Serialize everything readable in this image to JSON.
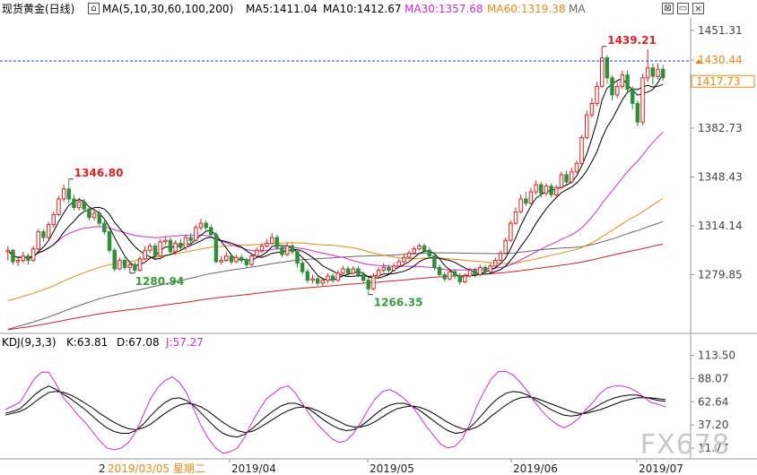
{
  "header": {
    "title": "现货黄金(日线)",
    "ma_label": "MA(5,10,30,60,100,200)",
    "ma5": "MA5:1411.04",
    "ma10": "MA10:1412.67",
    "ma30": "MA30:1357.68",
    "ma60": "MA60:1319.38",
    "ma_more": "MA"
  },
  "kdj_header": {
    "label": "KDJ(9,3,3)",
    "k": "K:63.81",
    "d": "D:67.08",
    "j": "J:57.27"
  },
  "colors": {
    "up": "#e02020",
    "down": "#2f8f3a",
    "ma5": "#000000",
    "ma10": "#000000",
    "ma30": "#d02ad0",
    "ma60": "#e88a10",
    "ma100": "#666666",
    "ma200": "#d42020",
    "current": "#1a3fd0",
    "k": "#000000",
    "d": "#000000",
    "j": "#d02ad0"
  },
  "chart_data": [
    {
      "type": "candlestick",
      "title": "现货黄金(日线)",
      "y_ticks": [
        1451.31,
        1430.44,
        1417.73,
        1382.73,
        1348.43,
        1314.14,
        1279.85
      ],
      "ylim": [
        1240,
        1460
      ],
      "current_price": "1417.73",
      "reference_price": "1430.44",
      "annotations": [
        {
          "label": "1346.80",
          "type": "high"
        },
        {
          "label": "1280.94",
          "type": "low"
        },
        {
          "label": "1266.35",
          "type": "low"
        },
        {
          "label": "1439.21",
          "type": "high"
        }
      ],
      "x_labels": [
        "2",
        "2019/03/05  星期二",
        "2019/04",
        "2019/05",
        "2019/06",
        "2019/07"
      ],
      "candles": [
        [
          1296,
          1297,
          1300,
          1290
        ],
        [
          1297,
          1289,
          1298,
          1287
        ],
        [
          1289,
          1290,
          1293,
          1286
        ],
        [
          1290,
          1293,
          1296,
          1288
        ],
        [
          1293,
          1290,
          1295,
          1287
        ],
        [
          1290,
          1298,
          1300,
          1289
        ],
        [
          1298,
          1310,
          1312,
          1297
        ],
        [
          1310,
          1306,
          1312,
          1303
        ],
        [
          1306,
          1315,
          1317,
          1305
        ],
        [
          1315,
          1322,
          1324,
          1313
        ],
        [
          1322,
          1333,
          1335,
          1321
        ],
        [
          1333,
          1340,
          1343,
          1331
        ],
        [
          1340,
          1333,
          1347,
          1330
        ],
        [
          1333,
          1327,
          1336,
          1325
        ],
        [
          1327,
          1331,
          1334,
          1325
        ],
        [
          1331,
          1326,
          1333,
          1324
        ],
        [
          1326,
          1320,
          1328,
          1318
        ],
        [
          1320,
          1323,
          1326,
          1318
        ],
        [
          1323,
          1316,
          1325,
          1314
        ],
        [
          1316,
          1310,
          1318,
          1308
        ],
        [
          1310,
          1297,
          1312,
          1295
        ],
        [
          1297,
          1284,
          1299,
          1282
        ],
        [
          1284,
          1290,
          1292,
          1283
        ],
        [
          1290,
          1285,
          1292,
          1283
        ],
        [
          1285,
          1287,
          1289,
          1281
        ],
        [
          1287,
          1283,
          1289,
          1281
        ],
        [
          1283,
          1291,
          1293,
          1282
        ],
        [
          1291,
          1297,
          1300,
          1290
        ],
        [
          1297,
          1300,
          1302,
          1295
        ],
        [
          1300,
          1293,
          1302,
          1291
        ],
        [
          1293,
          1303,
          1305,
          1292
        ],
        [
          1303,
          1304,
          1307,
          1301
        ],
        [
          1304,
          1296,
          1306,
          1294
        ],
        [
          1296,
          1302,
          1304,
          1294
        ],
        [
          1302,
          1299,
          1305,
          1297
        ],
        [
          1299,
          1306,
          1308,
          1297
        ],
        [
          1306,
          1304,
          1309,
          1302
        ],
        [
          1304,
          1313,
          1315,
          1303
        ],
        [
          1313,
          1316,
          1319,
          1311
        ],
        [
          1316,
          1313,
          1318,
          1311
        ],
        [
          1313,
          1308,
          1315,
          1306
        ],
        [
          1308,
          1289,
          1310,
          1288
        ],
        [
          1289,
          1290,
          1293,
          1287
        ],
        [
          1290,
          1293,
          1296,
          1289
        ],
        [
          1293,
          1289,
          1295,
          1287
        ],
        [
          1289,
          1292,
          1294,
          1288
        ],
        [
          1292,
          1290,
          1294,
          1288
        ],
        [
          1290,
          1287,
          1292,
          1285
        ],
        [
          1287,
          1293,
          1295,
          1286
        ],
        [
          1293,
          1297,
          1299,
          1292
        ],
        [
          1297,
          1300,
          1302,
          1295
        ],
        [
          1300,
          1302,
          1305,
          1299
        ],
        [
          1302,
          1306,
          1309,
          1301
        ],
        [
          1306,
          1299,
          1308,
          1297
        ],
        [
          1299,
          1294,
          1301,
          1292
        ],
        [
          1294,
          1300,
          1302,
          1293
        ],
        [
          1300,
          1296,
          1302,
          1294
        ],
        [
          1296,
          1288,
          1298,
          1285
        ],
        [
          1288,
          1282,
          1290,
          1280
        ],
        [
          1282,
          1276,
          1284,
          1274
        ],
        [
          1276,
          1277,
          1280,
          1274
        ],
        [
          1277,
          1274,
          1279,
          1272
        ],
        [
          1274,
          1276,
          1278,
          1272
        ],
        [
          1276,
          1279,
          1281,
          1274
        ],
        [
          1279,
          1276,
          1281,
          1274
        ],
        [
          1276,
          1281,
          1283,
          1275
        ],
        [
          1281,
          1284,
          1286,
          1280
        ],
        [
          1284,
          1281,
          1286,
          1279
        ],
        [
          1281,
          1284,
          1286,
          1280
        ],
        [
          1284,
          1280,
          1286,
          1278
        ],
        [
          1280,
          1276,
          1282,
          1274
        ],
        [
          1276,
          1270,
          1278,
          1266
        ],
        [
          1270,
          1279,
          1281,
          1269
        ],
        [
          1279,
          1283,
          1285,
          1278
        ],
        [
          1283,
          1285,
          1288,
          1281
        ],
        [
          1285,
          1283,
          1287,
          1281
        ],
        [
          1283,
          1286,
          1288,
          1282
        ],
        [
          1286,
          1289,
          1291,
          1285
        ],
        [
          1289,
          1292,
          1294,
          1288
        ],
        [
          1292,
          1295,
          1297,
          1291
        ],
        [
          1295,
          1298,
          1300,
          1294
        ],
        [
          1298,
          1300,
          1302,
          1297
        ],
        [
          1300,
          1297,
          1302,
          1295
        ],
        [
          1297,
          1293,
          1299,
          1291
        ],
        [
          1293,
          1285,
          1295,
          1283
        ],
        [
          1285,
          1280,
          1287,
          1278
        ],
        [
          1280,
          1277,
          1282,
          1275
        ],
        [
          1277,
          1282,
          1284,
          1276
        ],
        [
          1282,
          1279,
          1284,
          1277
        ],
        [
          1279,
          1275,
          1281,
          1273
        ],
        [
          1275,
          1279,
          1281,
          1274
        ],
        [
          1279,
          1283,
          1285,
          1278
        ],
        [
          1283,
          1280,
          1285,
          1278
        ],
        [
          1280,
          1285,
          1287,
          1279
        ],
        [
          1285,
          1282,
          1287,
          1280
        ],
        [
          1282,
          1286,
          1288,
          1281
        ],
        [
          1286,
          1290,
          1292,
          1285
        ],
        [
          1290,
          1295,
          1297,
          1289
        ],
        [
          1295,
          1304,
          1306,
          1294
        ],
        [
          1304,
          1316,
          1318,
          1303
        ],
        [
          1316,
          1324,
          1327,
          1315
        ],
        [
          1324,
          1333,
          1336,
          1323
        ],
        [
          1333,
          1330,
          1338,
          1328
        ],
        [
          1330,
          1338,
          1341,
          1329
        ],
        [
          1338,
          1343,
          1346,
          1336
        ],
        [
          1343,
          1337,
          1345,
          1334
        ],
        [
          1337,
          1342,
          1344,
          1335
        ],
        [
          1342,
          1336,
          1344,
          1334
        ],
        [
          1336,
          1341,
          1343,
          1334
        ],
        [
          1341,
          1350,
          1352,
          1340
        ],
        [
          1350,
          1345,
          1353,
          1343
        ],
        [
          1345,
          1352,
          1355,
          1344
        ],
        [
          1352,
          1358,
          1360,
          1351
        ],
        [
          1358,
          1376,
          1378,
          1357
        ],
        [
          1376,
          1392,
          1395,
          1375
        ],
        [
          1392,
          1400,
          1404,
          1390
        ],
        [
          1400,
          1412,
          1415,
          1398
        ],
        [
          1412,
          1432,
          1440,
          1411
        ],
        [
          1432,
          1418,
          1434,
          1414
        ],
        [
          1418,
          1406,
          1420,
          1402
        ],
        [
          1406,
          1412,
          1415,
          1404
        ],
        [
          1412,
          1420,
          1423,
          1410
        ],
        [
          1420,
          1410,
          1423,
          1407
        ],
        [
          1410,
          1400,
          1412,
          1396
        ],
        [
          1400,
          1387,
          1402,
          1384
        ],
        [
          1387,
          1418,
          1421,
          1385
        ],
        [
          1418,
          1425,
          1438,
          1415
        ],
        [
          1425,
          1419,
          1428,
          1413
        ],
        [
          1419,
          1424,
          1428,
          1417
        ],
        [
          1424,
          1418,
          1427,
          1416
        ]
      ]
    },
    {
      "type": "line",
      "title": "KDJ(9,3,3)",
      "y_ticks": [
        113.5,
        88.07,
        62.64,
        37.2,
        11.77
      ],
      "ylim": [
        0,
        120
      ],
      "series": [
        {
          "name": "K",
          "values": [
            50,
            52,
            55,
            62,
            70,
            76,
            80,
            76,
            71,
            66,
            60,
            54,
            47,
            40,
            34,
            30,
            28,
            28,
            31,
            38,
            47,
            55,
            62,
            66,
            67,
            64,
            58,
            50,
            42,
            34,
            28,
            25,
            24,
            27,
            33,
            40,
            47,
            53,
            58,
            61,
            61,
            58,
            54,
            48,
            42,
            37,
            33,
            31,
            32,
            36,
            42,
            49,
            55,
            59,
            61,
            61,
            58,
            54,
            48,
            42,
            36,
            31,
            28,
            29,
            34,
            42,
            51,
            60,
            67,
            72,
            74,
            73,
            70,
            65,
            60,
            55,
            51,
            48,
            47,
            48,
            51,
            55,
            60,
            64,
            67,
            69,
            70,
            70,
            68,
            66,
            64,
            63
          ]
        },
        {
          "name": "D",
          "values": [
            48,
            50,
            52,
            56,
            62,
            68,
            73,
            74,
            73,
            70,
            66,
            61,
            56,
            50,
            45,
            40,
            36,
            33,
            32,
            34,
            38,
            44,
            50,
            55,
            59,
            61,
            60,
            57,
            52,
            46,
            40,
            35,
            31,
            29,
            30,
            34,
            39,
            44,
            49,
            53,
            56,
            57,
            56,
            53,
            49,
            45,
            41,
            37,
            35,
            35,
            37,
            41,
            46,
            51,
            55,
            57,
            58,
            57,
            54,
            50,
            45,
            40,
            36,
            33,
            32,
            35,
            40,
            47,
            53,
            59,
            64,
            67,
            68,
            67,
            64,
            61,
            58,
            55,
            52,
            50,
            50,
            52,
            54,
            57,
            60,
            63,
            65,
            67,
            67,
            67,
            66,
            65
          ]
        },
        {
          "name": "J",
          "values": [
            54,
            58,
            62,
            75,
            88,
            95,
            95,
            82,
            67,
            58,
            48,
            40,
            30,
            20,
            12,
            10,
            12,
            18,
            30,
            48,
            66,
            78,
            86,
            90,
            84,
            72,
            54,
            36,
            22,
            12,
            6,
            8,
            12,
            24,
            40,
            54,
            66,
            72,
            78,
            80,
            72,
            60,
            48,
            38,
            30,
            22,
            18,
            20,
            28,
            40,
            54,
            66,
            74,
            76,
            72,
            66,
            58,
            48,
            36,
            26,
            16,
            12,
            14,
            22,
            38,
            58,
            74,
            88,
            96,
            96,
            92,
            84,
            74,
            62,
            52,
            44,
            38,
            34,
            38,
            44,
            54,
            62,
            72,
            78,
            80,
            80,
            78,
            74,
            68,
            62,
            60,
            57
          ]
        }
      ]
    }
  ],
  "watermark": "FX678"
}
